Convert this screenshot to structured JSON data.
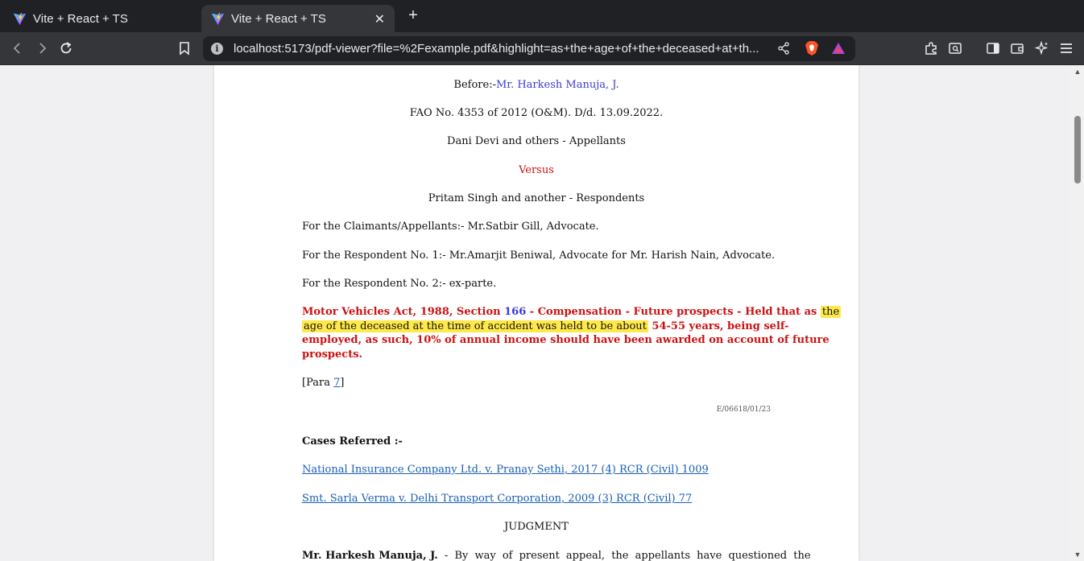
{
  "tabs": [
    {
      "label": "Vite + React + TS",
      "active": false
    },
    {
      "label": "Vite + React + TS",
      "active": true
    }
  ],
  "toolbar": {
    "url": "localhost:5173/pdf-viewer?file=%2Fexample.pdf&highlight=as+the+age+of+the+deceased+at+th..."
  },
  "document": {
    "before_prefix": "Before:-",
    "judge": "Mr. Harkesh Manuja, J.",
    "case_no": "FAO No. 4353 of 2012 (O&M). D/d. 13.09.2022.",
    "appellants": "Dani Devi and others - Appellants",
    "versus": "Versus",
    "respondents": "Pritam Singh and another - Respondents",
    "claimants_counsel": "For the Claimants/Appellants:- Mr.Satbir Gill, Advocate.",
    "respondent1_counsel": "For the Respondent No. 1:- Mr.Amarjit Beniwal, Advocate for Mr. Harish Nain, Advocate.",
    "respondent2_counsel": "For the Respondent No. 2:- ex-parte.",
    "headnote_part1": "Motor Vehicles Act, 1988, Section ",
    "headnote_section": "166",
    "headnote_part2": " - Compensation - Future prospects - Held that as ",
    "headnote_hl1": "the",
    "headnote_hl2": "age of the deceased at the time of accident was held to be about",
    "headnote_part3": " 54-55 years, being self-",
    "headnote_line3": "employed, as such, 10% of annual income should have been awarded on account of future",
    "headnote_line4": "prospects.",
    "para_prefix": "[Para ",
    "para_num": "7",
    "para_suffix": "]",
    "ref_code": "E/06618/01/23",
    "cases_referred_heading": "Cases Referred :-",
    "case1": "National Insurance Company Ltd. v. Pranay Sethi, 2017 (4) RCR (Civil) 1009",
    "case2": "Smt. Sarla Verma v. Delhi Transport Corporation, 2009 (3) RCR (Civil) 77",
    "judgment_heading": "JUDGMENT",
    "judgment_judge": "Mr. Harkesh Manuja, J.",
    "judgment_text": " - By way of present appeal, the appellants have questioned the"
  },
  "colors": {
    "highlight": "#ffe94a",
    "headnote_red": "#cc1111",
    "link_blue": "#1a5fb4",
    "judge_blue": "#3b3bd6"
  }
}
